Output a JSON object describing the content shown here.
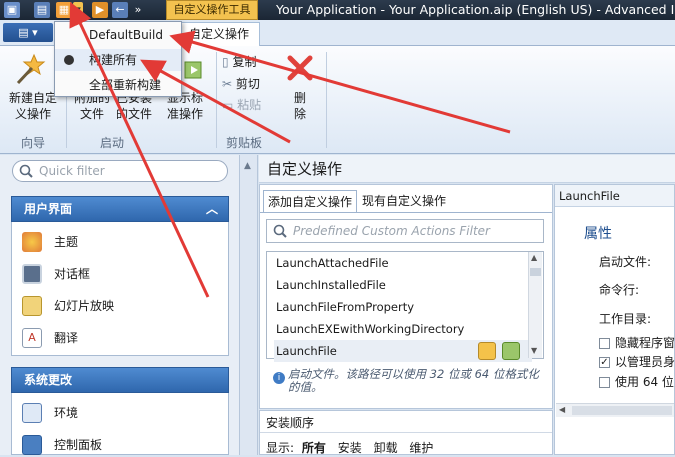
{
  "window": {
    "context_tab": "自定义操作工具",
    "title": "Your Application - Your Application.aip (English US) - Advanced Insta"
  },
  "ribbon_tabs": {
    "custom_actions_tab": "自定义操作"
  },
  "dropdown": {
    "items": [
      {
        "label": "DefaultBuild"
      },
      {
        "label": "构建所有"
      },
      {
        "label": "全部重新构建"
      }
    ]
  },
  "ribbon": {
    "new_action": {
      "line1": "新建自定",
      "line2": "义操作"
    },
    "add_file": {
      "line1": "附加的",
      "line2": "文件"
    },
    "change_file": {
      "line1": "已安装",
      "line2": "的文件"
    },
    "show_std": {
      "line1": "显示标",
      "line2": "准操作"
    },
    "copy": "复制",
    "cut": "剪切",
    "paste": "粘贴",
    "delete": {
      "line1": "删",
      "line2": "除"
    },
    "groups": {
      "guide": "向导",
      "launch": "启动",
      "clipboard": "剪贴板"
    }
  },
  "left": {
    "filter_placeholder": "Quick filter",
    "group1": {
      "title": "用户界面",
      "items": [
        {
          "label": "主题"
        },
        {
          "label": "对话框"
        },
        {
          "label": "幻灯片放映"
        },
        {
          "label": "翻译"
        }
      ]
    },
    "group2": {
      "title": "系统更改",
      "items": [
        {
          "label": "环境"
        },
        {
          "label": "控制面板"
        }
      ]
    }
  },
  "main": {
    "header": "自定义操作",
    "tabs": [
      {
        "label": "添加自定义操作"
      },
      {
        "label": "现有自定义操作"
      }
    ],
    "filter_placeholder": "Predefined Custom Actions Filter",
    "actions": [
      {
        "label": "LaunchAttachedFile"
      },
      {
        "label": "LaunchInstalledFile"
      },
      {
        "label": "LaunchFileFromProperty"
      },
      {
        "label": "LaunchEXEwithWorkingDirectory"
      },
      {
        "label": "LaunchFile"
      }
    ],
    "hint": "启动文件。该路径可以使用 32 位或 64 位格式化的值。",
    "sequence": {
      "title": "安装顺序",
      "show_label": "显示:",
      "filters": [
        {
          "label": "所有"
        },
        {
          "label": "安装"
        },
        {
          "label": "卸载"
        },
        {
          "label": "维护"
        }
      ]
    }
  },
  "props": {
    "header": "LaunchFile",
    "title": "属性",
    "fields": [
      {
        "label": "启动文件:"
      },
      {
        "label": "命令行:"
      },
      {
        "label": "工作目录:"
      }
    ],
    "checks": [
      {
        "label": "隐藏程序窗"
      },
      {
        "label": "以管理员身"
      },
      {
        "label": "使用 64 位"
      }
    ]
  },
  "colors": {
    "accent": "#2f67ad",
    "arrow": "#e23a36",
    "context_tab": "#f3c24f"
  }
}
